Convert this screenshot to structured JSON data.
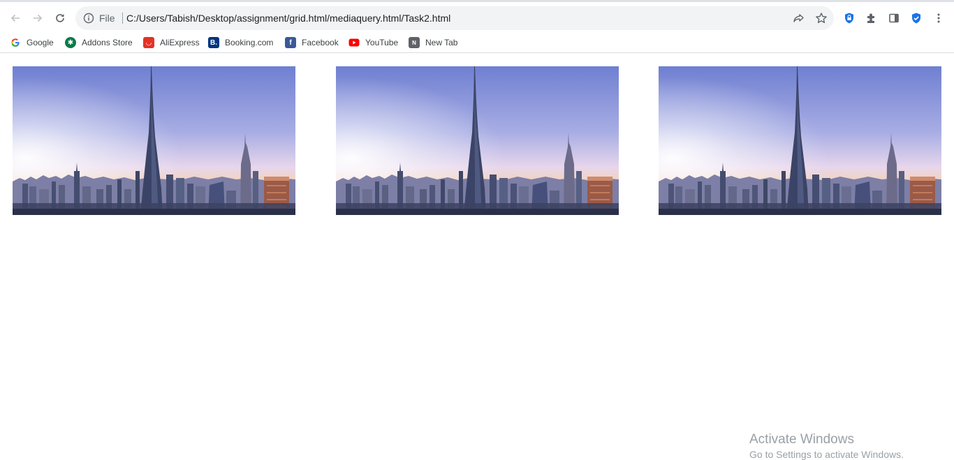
{
  "omnibox": {
    "scheme_label": "File",
    "url": "C:/Users/Tabish/Desktop/assignment/grid.html/mediaquery.html/Task2.html"
  },
  "toolbar_icons": [
    "back-icon",
    "forward-icon",
    "reload-icon",
    "info-icon",
    "share-icon",
    "star-icon",
    "shield-extension-icon",
    "puzzle-icon",
    "side-panel-icon",
    "check-shield-icon",
    "more-vert-icon"
  ],
  "bookmarks": [
    {
      "label": "Google",
      "icon": "google-icon",
      "color": "#4285f4"
    },
    {
      "label": "Addons Store",
      "icon": "addons-icon",
      "color": "#0b7a4b"
    },
    {
      "label": "AliExpress",
      "icon": "aliexpress-icon",
      "color": "#e43225"
    },
    {
      "label": "Booking.com",
      "icon": "booking-icon",
      "color": "#003580"
    },
    {
      "label": "Facebook",
      "icon": "facebook-icon",
      "color": "#3b5998"
    },
    {
      "label": "YouTube",
      "icon": "youtube-icon",
      "color": "#ff0000"
    },
    {
      "label": "New Tab",
      "icon": "newtab-icon",
      "color": "#5f6368"
    }
  ],
  "images": [
    {
      "subject": "Dubai skyline at dusk"
    },
    {
      "subject": "Dubai skyline at dusk"
    },
    {
      "subject": "Dubai skyline at dusk"
    }
  ],
  "watermark": {
    "title": "Activate Windows",
    "subtitle": "Go to Settings to activate Windows."
  }
}
